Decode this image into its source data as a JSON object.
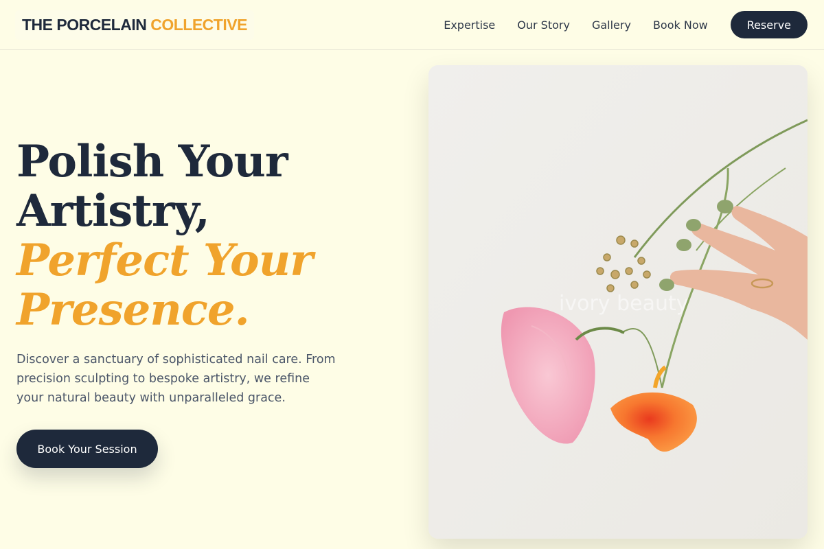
{
  "brand": {
    "part1": "THE PORCELAIN",
    "part2": "COLLECTIVE"
  },
  "nav": {
    "items": [
      {
        "label": "Expertise"
      },
      {
        "label": "Our Story"
      },
      {
        "label": "Gallery"
      },
      {
        "label": "Book Now"
      }
    ],
    "reserve_label": "Reserve"
  },
  "hero": {
    "title_line1": "Polish Your",
    "title_line2": "Artistry,",
    "accent_line1": "Perfect Your",
    "accent_line2": "Presence.",
    "lead": "Discover a sanctuary of sophisticated nail care. From precision sculpting to bespoke artistry, we refine your natural beauty with unparalleled grace.",
    "cta_label": "Book Your Session",
    "image_watermark": "ivory beauty"
  },
  "colors": {
    "background": "#fefde6",
    "navy": "#1e293b",
    "accent": "#f0a32c"
  }
}
